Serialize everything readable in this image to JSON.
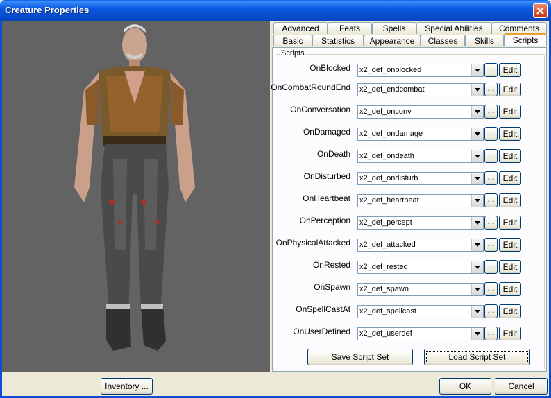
{
  "window": {
    "title": "Creature Properties"
  },
  "tabs_back": [
    "Advanced",
    "Feats",
    "Spells",
    "Special Abilities",
    "Comments"
  ],
  "tabs_front": [
    "Basic",
    "Statistics",
    "Appearance",
    "Classes",
    "Skills",
    "Scripts"
  ],
  "active_tab": "Scripts",
  "scripts": {
    "group_label": "Scripts",
    "browse_label": "...",
    "edit_label": "Edit",
    "rows": [
      {
        "label": "OnBlocked",
        "value": "x2_def_onblocked"
      },
      {
        "label": "OnCombatRoundEnd",
        "value": "x2_def_endcombat"
      },
      {
        "label": "OnConversation",
        "value": "x2_def_onconv"
      },
      {
        "label": "OnDamaged",
        "value": "x2_def_ondamage"
      },
      {
        "label": "OnDeath",
        "value": "x2_def_ondeath"
      },
      {
        "label": "OnDisturbed",
        "value": "x2_def_ondisturb"
      },
      {
        "label": "OnHeartbeat",
        "value": "x2_def_heartbeat"
      },
      {
        "label": "OnPerception",
        "value": "x2_def_percept"
      },
      {
        "label": "OnPhysicalAttacked",
        "value": "x2_def_attacked"
      },
      {
        "label": "OnRested",
        "value": "x2_def_rested"
      },
      {
        "label": "OnSpawn",
        "value": "x2_def_spawn"
      },
      {
        "label": "OnSpellCastAt",
        "value": "x2_def_spellcast"
      },
      {
        "label": "OnUserDefined",
        "value": "x2_def_userdef"
      }
    ],
    "save_set": "Save Script Set",
    "load_set": "Load Script Set"
  },
  "buttons": {
    "inventory": "Inventory ...",
    "ok": "OK",
    "cancel": "Cancel"
  },
  "colors": {
    "titlebar": "#0b58e0",
    "preview_bg": "#636363",
    "dialog_bg": "#ece9d8"
  }
}
